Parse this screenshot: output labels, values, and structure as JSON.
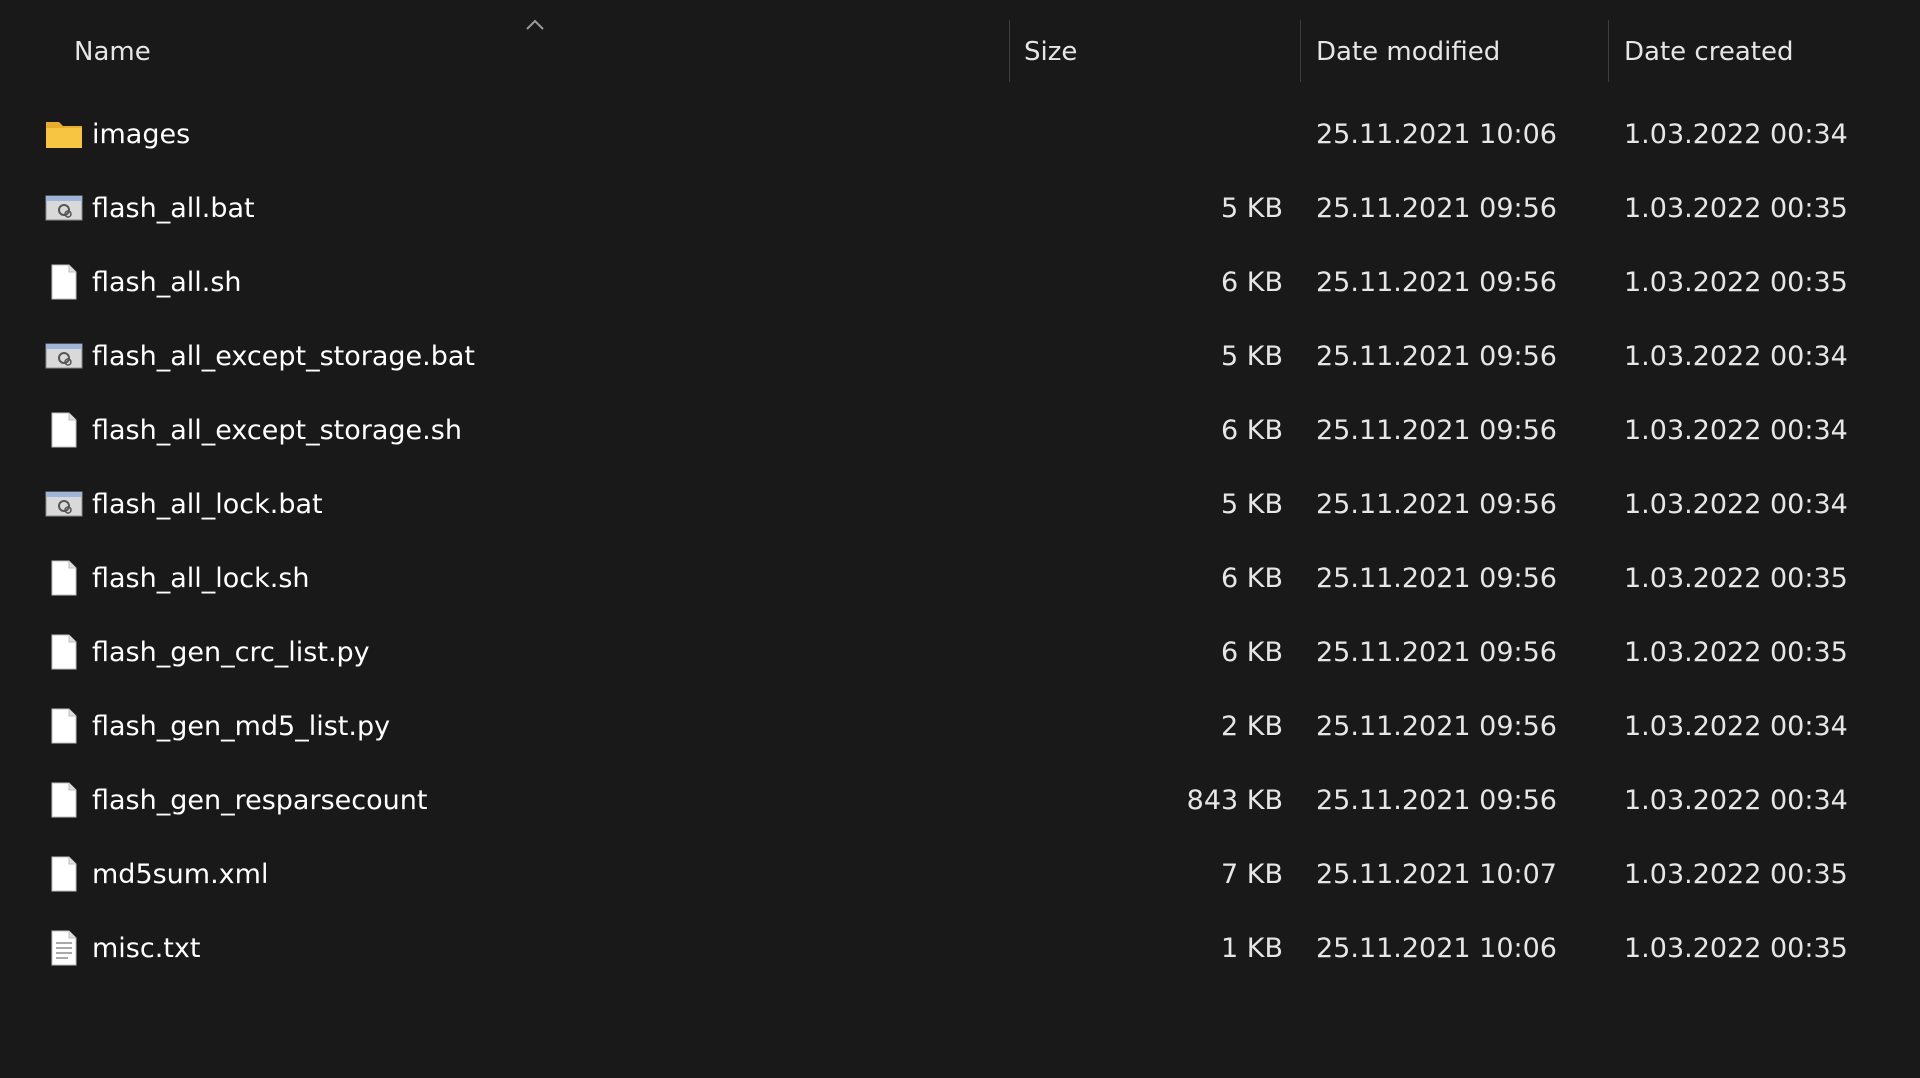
{
  "columns": {
    "name": "Name",
    "size": "Size",
    "date_modified": "Date modified",
    "date_created": "Date created",
    "sort_indicator": "chevron-up-icon"
  },
  "files": [
    {
      "name": "images",
      "size": "",
      "modified": "25.11.2021 10:06",
      "created": "1.03.2022 00:34",
      "icon": "folder-icon"
    },
    {
      "name": "flash_all.bat",
      "size": "5 KB",
      "modified": "25.11.2021 09:56",
      "created": "1.03.2022 00:35",
      "icon": "batch-file-icon"
    },
    {
      "name": "flash_all.sh",
      "size": "6 KB",
      "modified": "25.11.2021 09:56",
      "created": "1.03.2022 00:35",
      "icon": "file-icon"
    },
    {
      "name": "flash_all_except_storage.bat",
      "size": "5 KB",
      "modified": "25.11.2021 09:56",
      "created": "1.03.2022 00:34",
      "icon": "batch-file-icon"
    },
    {
      "name": "flash_all_except_storage.sh",
      "size": "6 KB",
      "modified": "25.11.2021 09:56",
      "created": "1.03.2022 00:34",
      "icon": "file-icon"
    },
    {
      "name": "flash_all_lock.bat",
      "size": "5 KB",
      "modified": "25.11.2021 09:56",
      "created": "1.03.2022 00:34",
      "icon": "batch-file-icon"
    },
    {
      "name": "flash_all_lock.sh",
      "size": "6 KB",
      "modified": "25.11.2021 09:56",
      "created": "1.03.2022 00:35",
      "icon": "file-icon"
    },
    {
      "name": "flash_gen_crc_list.py",
      "size": "6 KB",
      "modified": "25.11.2021 09:56",
      "created": "1.03.2022 00:35",
      "icon": "file-icon"
    },
    {
      "name": "flash_gen_md5_list.py",
      "size": "2 KB",
      "modified": "25.11.2021 09:56",
      "created": "1.03.2022 00:34",
      "icon": "file-icon"
    },
    {
      "name": "flash_gen_resparsecount",
      "size": "843 KB",
      "modified": "25.11.2021 09:56",
      "created": "1.03.2022 00:34",
      "icon": "file-icon"
    },
    {
      "name": "md5sum.xml",
      "size": "7 KB",
      "modified": "25.11.2021 10:07",
      "created": "1.03.2022 00:35",
      "icon": "file-icon"
    },
    {
      "name": "misc.txt",
      "size": "1 KB",
      "modified": "25.11.2021 10:06",
      "created": "1.03.2022 00:35",
      "icon": "text-file-icon"
    }
  ],
  "colors": {
    "background": "#191919",
    "text": "#ffffff",
    "separator": "#3d3d3d",
    "folder": "#f7c542"
  }
}
